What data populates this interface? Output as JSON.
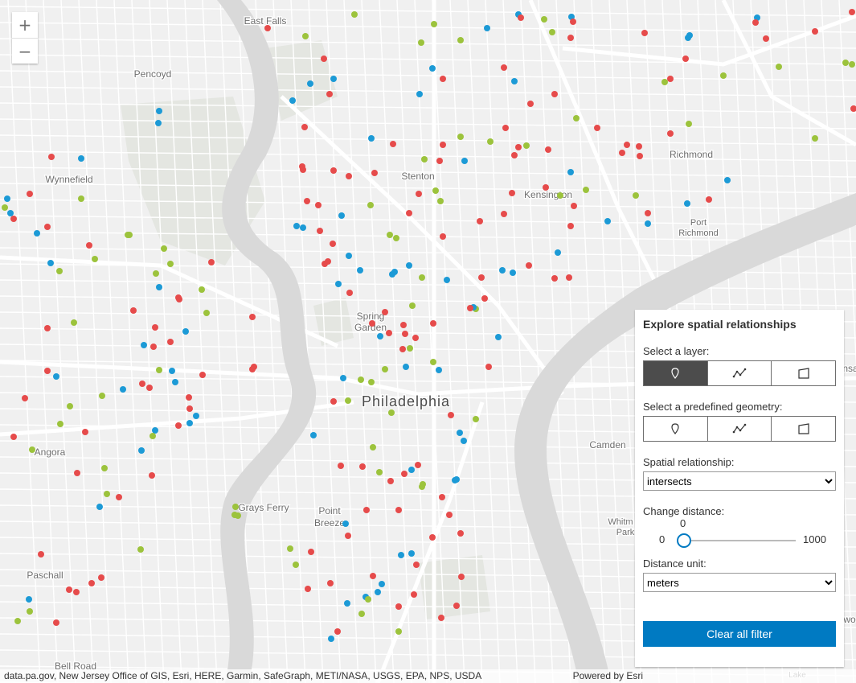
{
  "map": {
    "place_labels": [
      {
        "text": "East Falls"
      },
      {
        "text": "Pencoyd"
      },
      {
        "text": "Wynnefield"
      },
      {
        "text": "Stenton"
      },
      {
        "text": "Kensington"
      },
      {
        "text": "Richmond"
      },
      {
        "text": "Port"
      },
      {
        "text": "Richmond"
      },
      {
        "text": "Spring"
      },
      {
        "text": "Garden"
      },
      {
        "text": "Philadelphia"
      },
      {
        "text": "Angora"
      },
      {
        "text": "Camden"
      },
      {
        "text": "Grays Ferry"
      },
      {
        "text": "Point"
      },
      {
        "text": "Breeze"
      },
      {
        "text": "Whitm"
      },
      {
        "text": "Park"
      },
      {
        "text": "Paschall"
      },
      {
        "text": "Bell Road"
      },
      {
        "text": "Lake"
      },
      {
        "text": "nsa"
      },
      {
        "text": "wo"
      }
    ],
    "point_colors": {
      "red": "#e64b4b",
      "blue": "#1c9ad6",
      "green": "#9cc33c"
    }
  },
  "zoom": {
    "in_label": "+",
    "out_label": "−"
  },
  "attribution": {
    "sources": "data.pa.gov, New Jersey Office of GIS, Esri, HERE, Garmin, SafeGraph, METI/NASA, USGS, EPA, NPS, USDA",
    "powered": "Powered by Esri"
  },
  "panel": {
    "title": "Explore spatial relationships",
    "layer_label": "Select a layer:",
    "layer_options": [
      "point-icon",
      "polyline-icon",
      "polygon-icon"
    ],
    "geometry_label": "Select a predefined geometry:",
    "geometry_options": [
      "point-icon",
      "polyline-icon",
      "polygon-icon"
    ],
    "relationship_label": "Spatial relationship:",
    "relationship_value": "intersects",
    "distance_label": "Change distance:",
    "distance_value": "0",
    "distance_min": "0",
    "distance_max": "1000",
    "unit_label": "Distance unit:",
    "unit_value": "meters",
    "clear_button": "Clear all filter",
    "accent": "#007ac2"
  }
}
